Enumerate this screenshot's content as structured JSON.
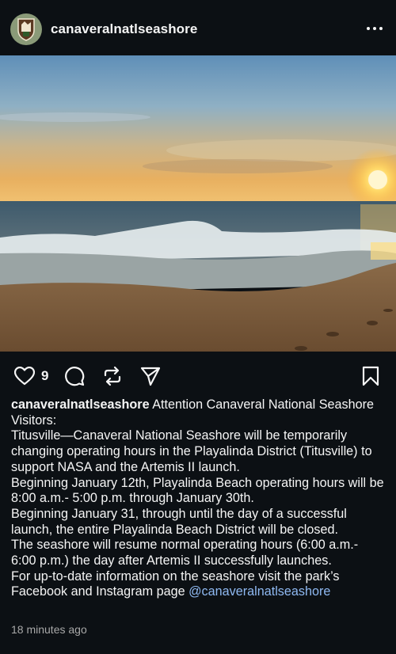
{
  "post": {
    "username": "canaveralnatlseashore",
    "like_count": "9",
    "caption_title": "Attention Canaveral National Seashore Visitors:",
    "caption_lines": [
      "Titusville—Canaveral National Seashore will be temporarily changing operating hours in the Playalinda District (Titusville) to support NASA and the Artemis II launch.",
      "Beginning January 12th, Playalinda Beach operating hours will be 8:00 a.m.- 5:00 p.m. through January 30th.",
      "Beginning January 31, through until the day of a successful launch, the entire Playalinda Beach District will be closed.",
      "The seashore will resume normal operating hours (6:00 a.m.- 6:00 p.m.) the day after Artemis II successfully launches."
    ],
    "caption_footer": "For up-to-date information on the seashore visit the park’s Facebook and Instagram page",
    "mention": "@canaveralnatlseashore",
    "timestamp": "18 minutes ago"
  },
  "icons": {
    "avatar": "nps-arrowhead-icon",
    "more": "more-options-icon",
    "like": "heart-icon",
    "comment": "comment-icon",
    "repost": "repost-icon",
    "share": "share-icon",
    "save": "bookmark-icon"
  },
  "colors": {
    "background": "#0c1014",
    "text": "#f5f5f5",
    "secondary_text": "#a8a8a8",
    "mention": "#8fb9f2"
  }
}
